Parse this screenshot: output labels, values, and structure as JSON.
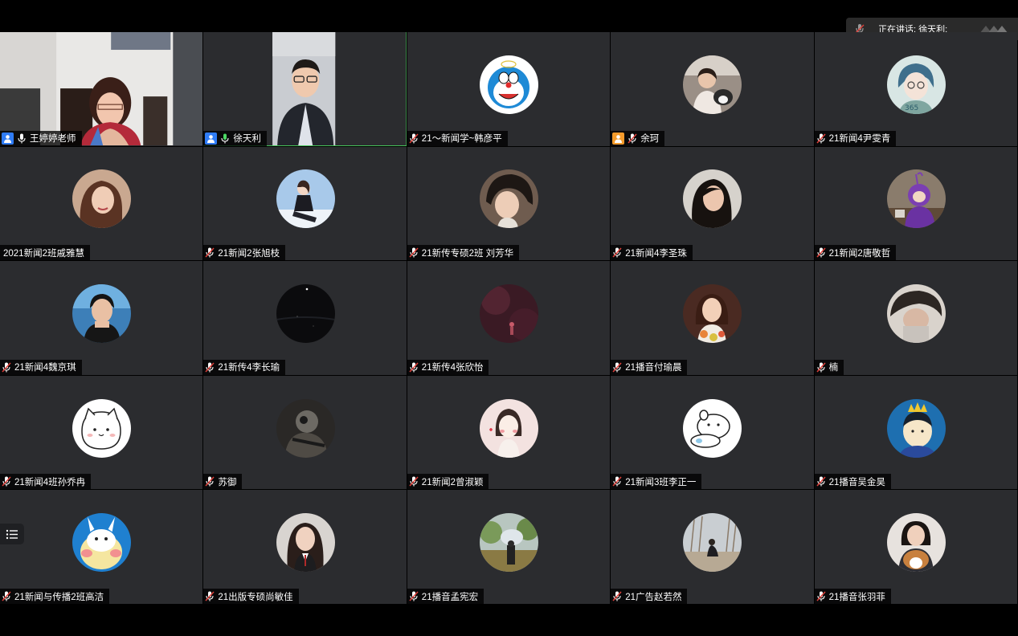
{
  "speaker": {
    "label": "正在讲话: 徐天利;"
  },
  "participants": [
    {
      "name": "王婷婷老师",
      "host": "blue",
      "mic": "on"
    },
    {
      "name": "徐天利",
      "host": "blue",
      "mic": "on-active"
    },
    {
      "name": "21～新闻学~韩彦平",
      "mic": "muted"
    },
    {
      "name": "余珂",
      "host": "orange",
      "mic": "muted"
    },
    {
      "name": "21新闻4尹雯青",
      "mic": "muted"
    },
    {
      "name": "2021新闻2班戚雅慧",
      "mic": "none"
    },
    {
      "name": "21新闻2张旭枝",
      "mic": "muted"
    },
    {
      "name": "21新传专硕2班 刘芳华",
      "mic": "muted"
    },
    {
      "name": "21新闻4李圣珠",
      "mic": "muted"
    },
    {
      "name": "21新闻2唐敬哲",
      "mic": "muted"
    },
    {
      "name": "21新闻4魏京琪",
      "mic": "muted"
    },
    {
      "name": "21新传4李长瑜",
      "mic": "muted"
    },
    {
      "name": "21新传4张欣怡",
      "mic": "muted"
    },
    {
      "name": "21播音付瑜晨",
      "mic": "muted"
    },
    {
      "name": "楠",
      "mic": "muted"
    },
    {
      "name": "21新闻4班孙乔冉",
      "mic": "muted"
    },
    {
      "name": "苏御",
      "mic": "muted"
    },
    {
      "name": "21新闻2曾淑颖",
      "mic": "muted"
    },
    {
      "name": "21新闻3班李正一",
      "mic": "muted"
    },
    {
      "name": "21播音吴金昊",
      "mic": "muted"
    },
    {
      "name": "21新闻与传播2班高洁",
      "mic": "muted"
    },
    {
      "name": "21出版专硕尚敏佳",
      "mic": "muted"
    },
    {
      "name": "21播音孟宪宏",
      "mic": "muted"
    },
    {
      "name": "21广告赵若然",
      "mic": "muted"
    },
    {
      "name": "21播音张羽菲",
      "mic": "muted"
    }
  ],
  "colors": {
    "tile_bg": "#2b2c2f",
    "active_border": "#47c25a",
    "host_blue": "#2f7cf6",
    "host_orange": "#f39a2b",
    "mute_red": "#e0403a"
  }
}
